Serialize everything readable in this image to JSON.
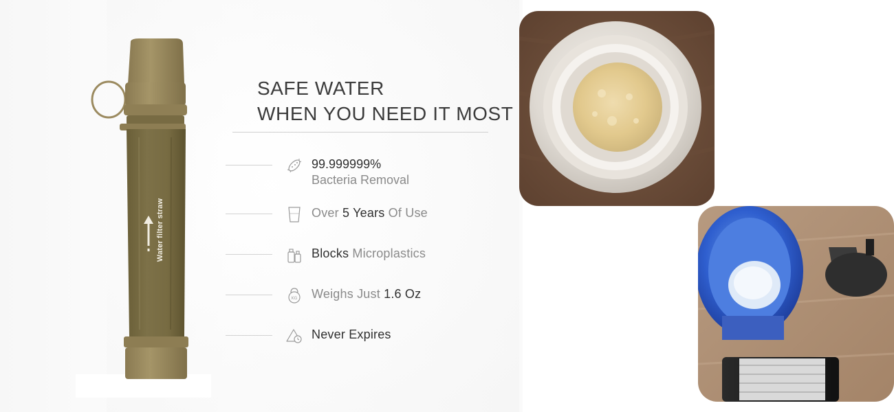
{
  "straw": {
    "label": "Water filter straw",
    "colors": {
      "body": "#7a6e45",
      "cap": "#9b8a5f"
    }
  },
  "headline": {
    "line1": "SAFE WATER",
    "line2": "WHEN YOU NEED IT MOST"
  },
  "features": [
    {
      "icon": "bacteria-icon",
      "line1_strong": "99.999999%",
      "line2": "Bacteria Removal"
    },
    {
      "icon": "glass-icon",
      "pre": "Over ",
      "strong": "5 Years",
      "post": " Of Use"
    },
    {
      "icon": "microplastics-icon",
      "pre": "",
      "strong": "Blocks",
      "post": " Microplastics"
    },
    {
      "icon": "kettlebell-icon",
      "pre": "Weighs Just ",
      "strong": "1.6 Oz",
      "post": ""
    },
    {
      "icon": "no-expiry-icon",
      "pre": "",
      "strong": "Never Expires",
      "post": ""
    }
  ],
  "photos": {
    "top": {
      "icon": "filter-membrane-closeup-photo"
    },
    "bottom": {
      "icon": "blue-bottle-with-filter-photo"
    }
  }
}
